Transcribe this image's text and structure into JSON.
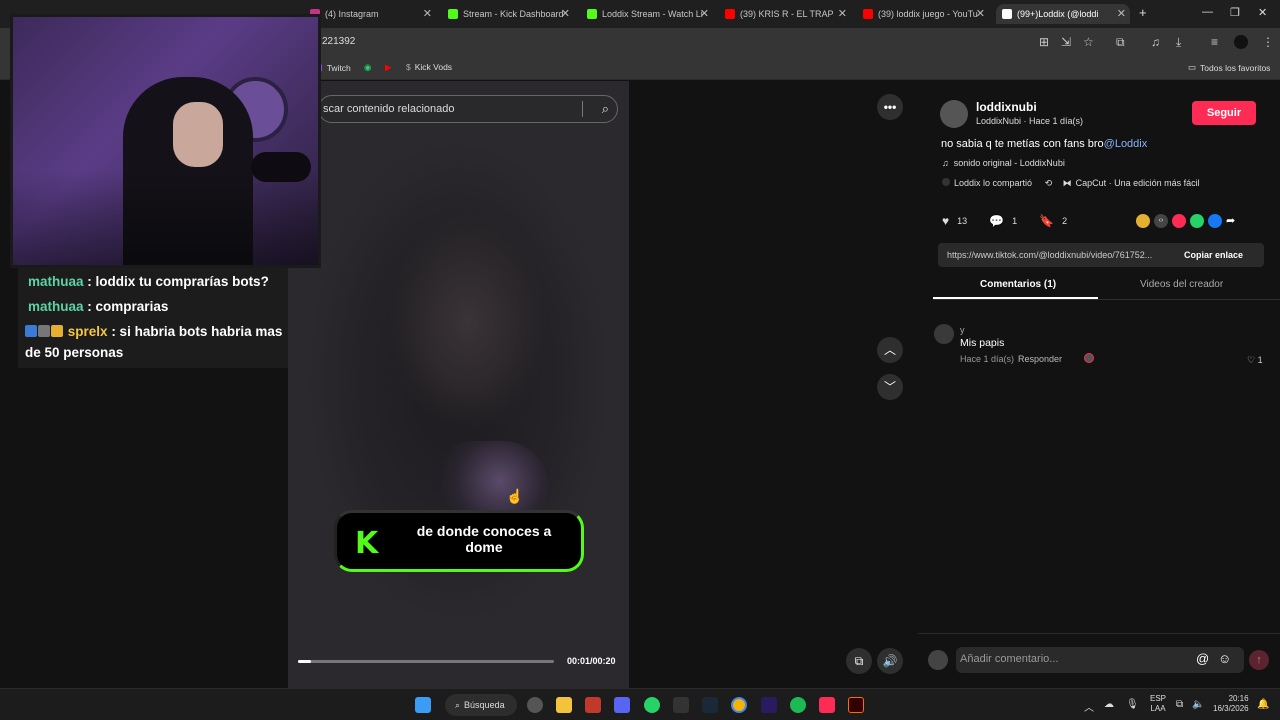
{
  "browser": {
    "tabs": [
      {
        "label": "(4) Instagram",
        "color": "#c13584"
      },
      {
        "label": "Stream - Kick Dashboard",
        "color": "#53fc18"
      },
      {
        "label": "Loddix Stream - Watch Li",
        "color": "#53fc18"
      },
      {
        "label": "(39) KRIS R - EL TRAP",
        "color": "#ff0000"
      },
      {
        "label": "(39) loddix juego - YouTu",
        "color": "#ff0000"
      },
      {
        "label": "(99+)Loddix (@loddi",
        "color": "#ffffff"
      }
    ],
    "url": "221392",
    "bookmarks": [
      "Twitch",
      "Kick Vods"
    ],
    "all_bookmarks": "Todos los favoritos"
  },
  "video": {
    "search_placeholder": "scar contenido relacionado",
    "overlay_text": "de donde conoces a dome",
    "time": "00:01/00:20",
    "progress": 0.05
  },
  "chat": [
    {
      "user": "mathuaa",
      "message": ": loddix tu comprarías bots?"
    },
    {
      "user": "mathuaa",
      "message": ": comprarias"
    },
    {
      "user": "sprelx",
      "message": ": si habria bots habria mas de 50 personas"
    }
  ],
  "post": {
    "username": "loddixnubi",
    "subtitle": "LoddixNubi · Hace 1 día(s)",
    "follow": "Seguir",
    "caption": "no sabia q te metías con fans bro",
    "mention": "@Loddix",
    "sound": "sonido original - LoddixNubi",
    "shared": "Loddix lo compartió",
    "capcut": "CapCut · Una edición más fácil",
    "likes": "13",
    "comments": "1",
    "saves": "2",
    "link": "https://www.tiktok.com/@loddixnubi/video/761752...",
    "copy": "Copiar enlace",
    "tab_comments": "Comentarios (1)",
    "tab_creator": "Videos del creador"
  },
  "comment": {
    "user": "y",
    "text": "Mis papis",
    "time": "Hace 1 día(s)",
    "reply": "Responder",
    "likes": "1"
  },
  "add_comment": "Añadir comentario...",
  "taskbar": {
    "search": "Búsqueda",
    "lang1": "ESP",
    "lang2": "LAA",
    "time": "20:16",
    "date": "16/3/2026"
  }
}
